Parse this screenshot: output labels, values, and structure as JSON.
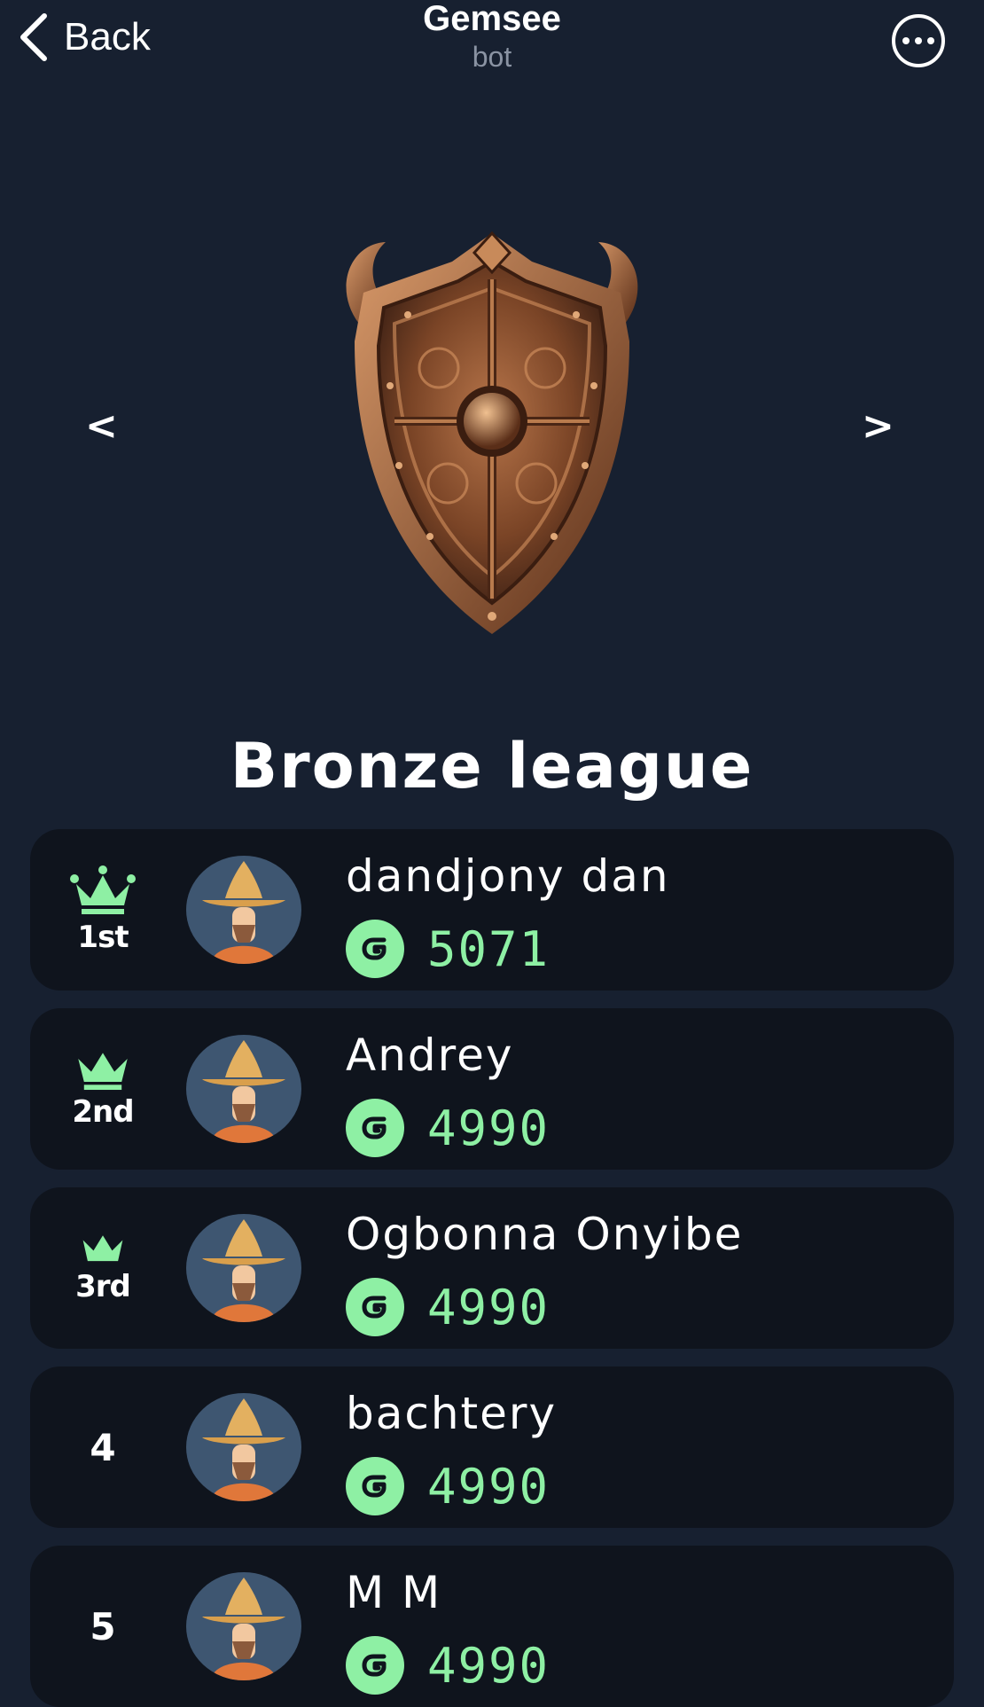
{
  "header": {
    "back_label": "Back",
    "title": "Gemsee",
    "subtitle": "bot"
  },
  "carousel": {
    "prev_label": "<",
    "next_label": ">",
    "league_name": "Bronze league"
  },
  "colors": {
    "background": "#172030",
    "card": "#0f141d",
    "accent": "#8ef0a4"
  },
  "leaderboard": [
    {
      "rank_label": "1st",
      "name": "dandjony dan",
      "score": "5071"
    },
    {
      "rank_label": "2nd",
      "name": "Andrey",
      "score": "4990"
    },
    {
      "rank_label": "3rd",
      "name": "Ogbonna Onyibe",
      "score": "4990"
    },
    {
      "rank_label": "4",
      "name": "bachtery",
      "score": "4990"
    },
    {
      "rank_label": "5",
      "name": "M M",
      "score": "4990"
    }
  ]
}
